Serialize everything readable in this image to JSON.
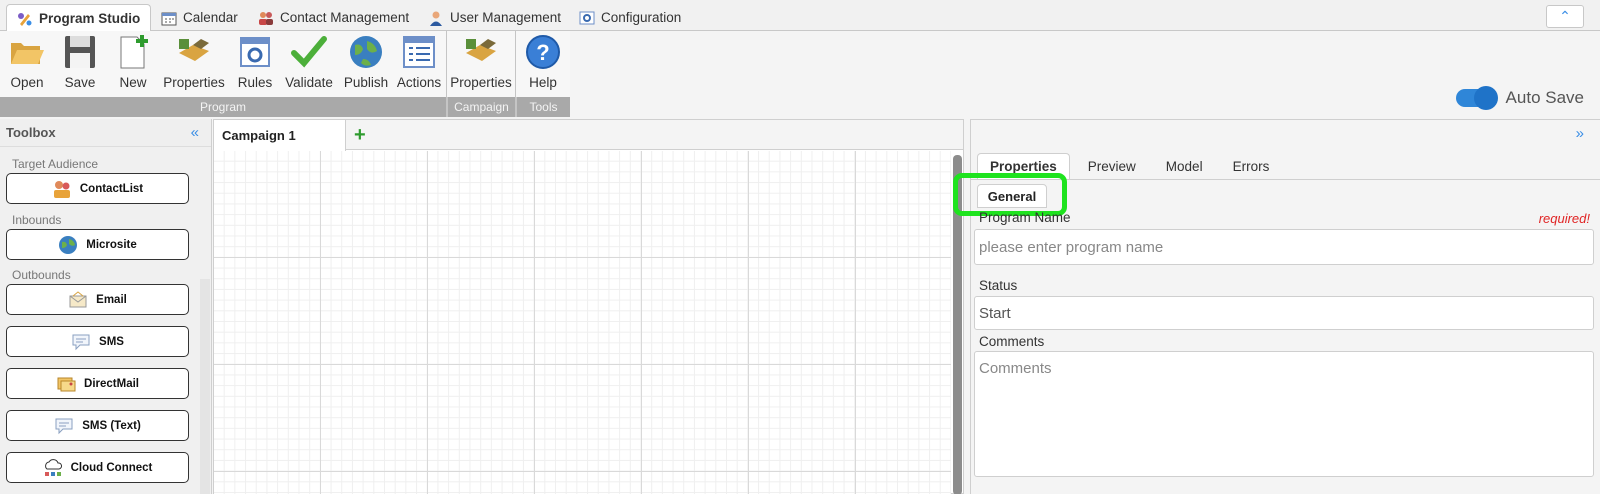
{
  "top_tabs": [
    {
      "label": "Program Studio",
      "icon": "program-studio-icon",
      "active": true
    },
    {
      "label": "Calendar",
      "icon": "calendar-icon",
      "active": false
    },
    {
      "label": "Contact Management",
      "icon": "contacts-icon",
      "active": false
    },
    {
      "label": "User Management",
      "icon": "user-icon",
      "active": false
    },
    {
      "label": "Configuration",
      "icon": "configuration-icon",
      "active": false
    }
  ],
  "ribbon": {
    "buttons": [
      {
        "label": "Open",
        "icon": "folder-open-icon"
      },
      {
        "label": "Save",
        "icon": "floppy-disk-icon"
      },
      {
        "label": "New",
        "icon": "new-document-icon"
      },
      {
        "label": "Properties",
        "icon": "properties-icon"
      },
      {
        "label": "Rules",
        "icon": "rules-icon"
      },
      {
        "label": "Validate",
        "icon": "checkmark-icon"
      },
      {
        "label": "Publish",
        "icon": "globe-icon"
      },
      {
        "label": "Actions",
        "icon": "list-icon"
      },
      {
        "label": "Properties",
        "icon": "properties-icon"
      },
      {
        "label": "Help",
        "icon": "help-icon"
      }
    ],
    "groups": [
      "Program",
      "Campaign",
      "Tools"
    ]
  },
  "autosave": {
    "label": "Auto Save",
    "enabled": true
  },
  "toolbox": {
    "title": "Toolbox",
    "sections": [
      "Target Audience",
      "Inbounds",
      "Outbounds"
    ],
    "items": [
      {
        "label": "ContactList",
        "icon": "contact-list-icon"
      },
      {
        "label": "Microsite",
        "icon": "globe-icon"
      },
      {
        "label": "Email",
        "icon": "envelope-icon"
      },
      {
        "label": "SMS",
        "icon": "speech-bubble-icon"
      },
      {
        "label": "DirectMail",
        "icon": "mail-icon"
      },
      {
        "label": "SMS (Text)",
        "icon": "speech-bubble-icon"
      },
      {
        "label": "Cloud Connect",
        "icon": "cloud-icon"
      }
    ]
  },
  "canvas": {
    "tab_label": "Campaign 1"
  },
  "right_panel": {
    "tabs": [
      "Properties",
      "Preview",
      "Model",
      "Errors"
    ],
    "subtab": "General",
    "fields": {
      "program_name_label": "Program Name",
      "required_label": "required!",
      "program_name_placeholder": "please enter program name",
      "status_label": "Status",
      "status_value": "Start",
      "comments_label": "Comments",
      "comments_placeholder": "Comments"
    }
  },
  "colors": {
    "accent": "#3a8ee6",
    "highlight": "#1ee31e",
    "required": "#e02424",
    "toggle": "#2f86d8"
  }
}
